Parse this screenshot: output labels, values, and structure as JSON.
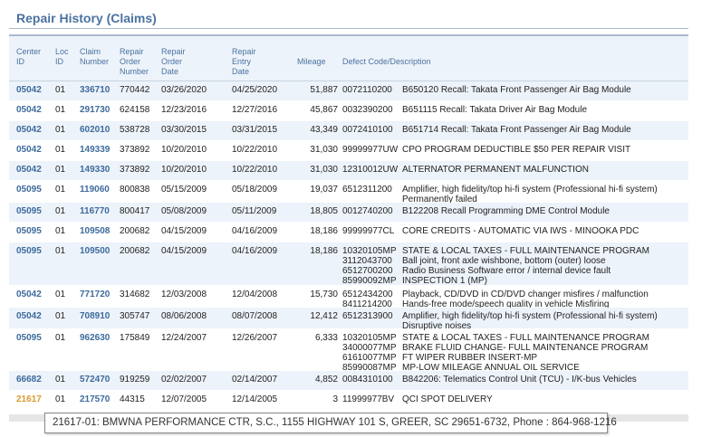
{
  "title": "Repair History (Claims)",
  "columns": {
    "center_id": "Center\nID",
    "loc_id": "Loc\nID",
    "claim_number": "Claim\nNumber",
    "repair_order_number": "Repair\nOrder\nNumber",
    "repair_order_date": "Repair\nOrder\nDate",
    "repair_entry_date": "Repair\nEntry\nDate",
    "mileage": "Mileage",
    "defect": "Defect Code/Description"
  },
  "rows": [
    {
      "center": "05042",
      "loc": "01",
      "claim": "336710",
      "ro_num": "770442",
      "ro_date": "03/26/2020",
      "entry_date": "04/25/2020",
      "mileage": "51,887",
      "defects": [
        {
          "code": "0072110200",
          "desc": "B650120 Recall: Takata Front Passenger Air Bag Module"
        }
      ]
    },
    {
      "center": "05042",
      "loc": "01",
      "claim": "291730",
      "ro_num": "624158",
      "ro_date": "12/23/2016",
      "entry_date": "12/27/2016",
      "mileage": "45,867",
      "defects": [
        {
          "code": "0032390200",
          "desc": "B651115 Recall: Takata Driver Air Bag Module"
        }
      ]
    },
    {
      "center": "05042",
      "loc": "01",
      "claim": "602010",
      "ro_num": "538728",
      "ro_date": "03/30/2015",
      "entry_date": "03/31/2015",
      "mileage": "43,349",
      "defects": [
        {
          "code": "0072410100",
          "desc": "B651714 Recall: Takata Front Passenger Air Bag Module"
        }
      ]
    },
    {
      "center": "05042",
      "loc": "01",
      "claim": "149339",
      "ro_num": "373892",
      "ro_date": "10/20/2010",
      "entry_date": "10/22/2010",
      "mileage": "31,030",
      "defects": [
        {
          "code": "99999977UW",
          "desc": "CPO PROGRAM DEDUCTIBLE $50 PER REPAIR VISIT"
        }
      ]
    },
    {
      "center": "05042",
      "loc": "01",
      "claim": "149330",
      "ro_num": "373892",
      "ro_date": "10/20/2010",
      "entry_date": "10/22/2010",
      "mileage": "31,030",
      "defects": [
        {
          "code": "12310012UW",
          "desc": "ALTERNATOR PERMANENT MALFUNCTION"
        }
      ]
    },
    {
      "center": "05095",
      "loc": "01",
      "claim": "119060",
      "ro_num": "800838",
      "ro_date": "05/15/2009",
      "entry_date": "05/18/2009",
      "mileage": "19,037",
      "defects": [
        {
          "code": "6512311200",
          "desc": "Amplifier, high fidelity/top hi-fi system (Professional hi-fi system) Permanently failed"
        }
      ]
    },
    {
      "center": "05095",
      "loc": "01",
      "claim": "116770",
      "ro_num": "800417",
      "ro_date": "05/08/2009",
      "entry_date": "05/11/2009",
      "mileage": "18,805",
      "defects": [
        {
          "code": "0012740200",
          "desc": "B122208 Recall Programming DME Control Module"
        }
      ]
    },
    {
      "center": "05095",
      "loc": "01",
      "claim": "109508",
      "ro_num": "200682",
      "ro_date": "04/15/2009",
      "entry_date": "04/16/2009",
      "mileage": "18,186",
      "defects": [
        {
          "code": "99999977CL",
          "desc": "CORE CREDITS - AUTOMATIC VIA IWS - MINOOKA PDC"
        }
      ]
    },
    {
      "center": "05095",
      "loc": "01",
      "claim": "109500",
      "ro_num": "200682",
      "ro_date": "04/15/2009",
      "entry_date": "04/16/2009",
      "mileage": "18,186",
      "defects": [
        {
          "code": "10320105MP",
          "desc": "STATE & LOCAL TAXES - FULL MAINTENANCE PROGRAM"
        },
        {
          "code": "3112043700",
          "desc": "Ball joint, front axle wishbone, bottom (outer) loose"
        },
        {
          "code": "6512700200",
          "desc": "Radio Business Software error / internal device fault"
        },
        {
          "code": "85990092MP",
          "desc": "INSPECTION 1 (MP)"
        }
      ]
    },
    {
      "center": "05042",
      "loc": "01",
      "claim": "771720",
      "ro_num": "314682",
      "ro_date": "12/03/2008",
      "entry_date": "12/04/2008",
      "mileage": "15,730",
      "defects": [
        {
          "code": "6512434200",
          "desc": "Playback, CD/DVD in CD/DVD changer misfires / malfunction"
        },
        {
          "code": "8411214200",
          "desc": "Hands-free mode/speech quality in vehicle Misfiring"
        }
      ]
    },
    {
      "center": "05042",
      "loc": "01",
      "claim": "708910",
      "ro_num": "305747",
      "ro_date": "08/06/2008",
      "entry_date": "08/07/2008",
      "mileage": "12,412",
      "defects": [
        {
          "code": "6512313900",
          "desc": "Amplifier, high fidelity/top hi-fi system (Professional hi-fi system) Disruptive noises"
        }
      ]
    },
    {
      "center": "05095",
      "loc": "01",
      "claim": "962630",
      "ro_num": "175849",
      "ro_date": "12/24/2007",
      "entry_date": "12/26/2007",
      "mileage": "6,333",
      "defects": [
        {
          "code": "10320105MP",
          "desc": "STATE & LOCAL TAXES - FULL MAINTENANCE PROGRAM"
        },
        {
          "code": "34000077MP",
          "desc": "BRAKE FLUID CHANGE- FULL MAINTENANCE PROGRAM"
        },
        {
          "code": "61610077MP",
          "desc": "FT WIPER RUBBER INSERT-MP"
        },
        {
          "code": "85990087MP",
          "desc": "MP-LOW MILEAGE ANNUAL OIL SERVICE"
        }
      ]
    },
    {
      "center": "66682",
      "loc": "01",
      "claim": "572470",
      "ro_num": "919259",
      "ro_date": "02/02/2007",
      "entry_date": "02/14/2007",
      "mileage": "4,852",
      "defects": [
        {
          "code": "0084310100",
          "desc": "B842206: Telematics Control Unit (TCU) - I/K-bus Vehicles"
        }
      ]
    },
    {
      "center": "21617",
      "loc": "01",
      "claim": "217570",
      "ro_num": "44315",
      "ro_date": "12/07/2005",
      "entry_date": "12/14/2005",
      "mileage": "3",
      "defects": [
        {
          "code": "11999977BV",
          "desc": "QCI SPOT DELIVERY"
        }
      ]
    }
  ],
  "highlight_center": "21617",
  "tooltip": "21617-01: BMWNA PERFORMANCE CTR, S.C., 1155 HIGHWAY 101 S, GREER, SC 29651-6732, Phone : 864-968-1216"
}
